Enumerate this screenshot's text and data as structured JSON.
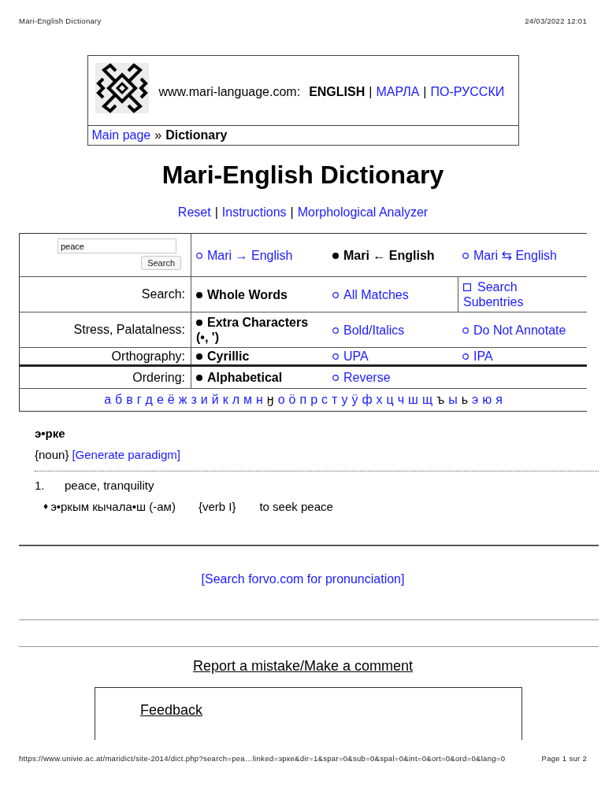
{
  "print_header": {
    "title": "Mari-English Dictionary",
    "datetime": "24/03/2022 12:01"
  },
  "site_header": {
    "domain": "www.mari-language.com:",
    "separator": "|",
    "languages": [
      {
        "label": "ENGLISH",
        "selected": true
      },
      {
        "label": "МАРЛА",
        "selected": false
      },
      {
        "label": "ПО-РУССКИ",
        "selected": false
      }
    ],
    "breadcrumb": {
      "link": "Main page",
      "separator": "»",
      "current": "Dictionary"
    }
  },
  "title": "Mari-English Dictionary",
  "nav": {
    "separator": "|",
    "links": [
      "Reset",
      "Instructions",
      "Morphological Analyzer"
    ]
  },
  "search_form": {
    "input": {
      "value": "peace"
    },
    "button": "Search",
    "directions": [
      {
        "label": "Mari → English",
        "selected": false
      },
      {
        "label": "Mari ← English",
        "selected": true
      },
      {
        "label": "Mari ⇆ English",
        "selected": false
      }
    ]
  },
  "option_rows": [
    {
      "label": "Search:",
      "options": [
        {
          "kind": "radio",
          "label": "Whole Words",
          "selected": true
        },
        {
          "kind": "radio",
          "label": "All Matches",
          "selected": false
        },
        {
          "kind": "checkbox",
          "label": "Search Subentries",
          "checked": false
        }
      ]
    },
    {
      "label": "Stress, Palatalness:",
      "options": [
        {
          "kind": "radio",
          "label": "Extra Characters (•, ')",
          "selected": true
        },
        {
          "kind": "radio",
          "label": "Bold/Italics",
          "selected": false
        },
        {
          "kind": "radio",
          "label": "Do Not Annotate",
          "selected": false
        }
      ]
    },
    {
      "label": "Orthography:",
      "options": [
        {
          "kind": "radio",
          "label": "Cyrillic",
          "selected": true
        },
        {
          "kind": "radio",
          "label": "UPA",
          "selected": false
        },
        {
          "kind": "radio",
          "label": "IPA",
          "selected": false
        }
      ]
    },
    {
      "label": "Ordering:",
      "options": [
        {
          "kind": "radio",
          "label": "Alphabetical",
          "selected": true
        },
        {
          "kind": "radio",
          "label": "Reverse",
          "selected": false
        }
      ]
    }
  ],
  "alphabet": [
    {
      "letter": "а",
      "linked": true
    },
    {
      "letter": "б",
      "linked": true
    },
    {
      "letter": "в",
      "linked": true
    },
    {
      "letter": "г",
      "linked": true
    },
    {
      "letter": "д",
      "linked": true
    },
    {
      "letter": "е",
      "linked": true
    },
    {
      "letter": "ё",
      "linked": true
    },
    {
      "letter": "ж",
      "linked": true
    },
    {
      "letter": "з",
      "linked": true
    },
    {
      "letter": "и",
      "linked": true
    },
    {
      "letter": "й",
      "linked": true
    },
    {
      "letter": "к",
      "linked": true
    },
    {
      "letter": "л",
      "linked": true
    },
    {
      "letter": "м",
      "linked": true
    },
    {
      "letter": "н",
      "linked": true
    },
    {
      "letter": "ӈ",
      "linked": false
    },
    {
      "letter": "о",
      "linked": true
    },
    {
      "letter": "ӧ",
      "linked": true
    },
    {
      "letter": "п",
      "linked": true
    },
    {
      "letter": "р",
      "linked": true
    },
    {
      "letter": "с",
      "linked": true
    },
    {
      "letter": "т",
      "linked": true
    },
    {
      "letter": "у",
      "linked": true
    },
    {
      "letter": "ӱ",
      "linked": true
    },
    {
      "letter": "ф",
      "linked": true
    },
    {
      "letter": "х",
      "linked": true
    },
    {
      "letter": "ц",
      "linked": true
    },
    {
      "letter": "ч",
      "linked": true
    },
    {
      "letter": "ш",
      "linked": true
    },
    {
      "letter": "щ",
      "linked": true
    },
    {
      "letter": "ъ",
      "linked": false
    },
    {
      "letter": "ы",
      "linked": true
    },
    {
      "letter": "ь",
      "linked": false
    },
    {
      "letter": "э",
      "linked": true
    },
    {
      "letter": "ю",
      "linked": true
    },
    {
      "letter": "я",
      "linked": true
    }
  ],
  "entry": {
    "headword": "э•рке",
    "part_of_speech": "{noun}",
    "paradigm_link": "[Generate paradigm]",
    "senses": [
      {
        "number": "1.",
        "gloss": "peace, tranquility"
      }
    ],
    "phrases": [
      {
        "marker": "♦",
        "phrase": "э•ркым кычала•ш (-ам)",
        "grammar": "{verb I}",
        "translation": "to seek peace"
      }
    ]
  },
  "forvo_link": "[Search forvo.com for pronunciation]",
  "report_link": "Report a mistake/Make a comment",
  "feedback": {
    "heading": "Feedback"
  },
  "print_footer": {
    "url": "https://www.univie.ac.at/maridict/site-2014/dict.php?search=pea…linked=эрке&dir=1&spar=0&sub=0&spal=0&int=0&ort=0&ord=0&lang=0",
    "page": "Page 1 sur 2"
  }
}
